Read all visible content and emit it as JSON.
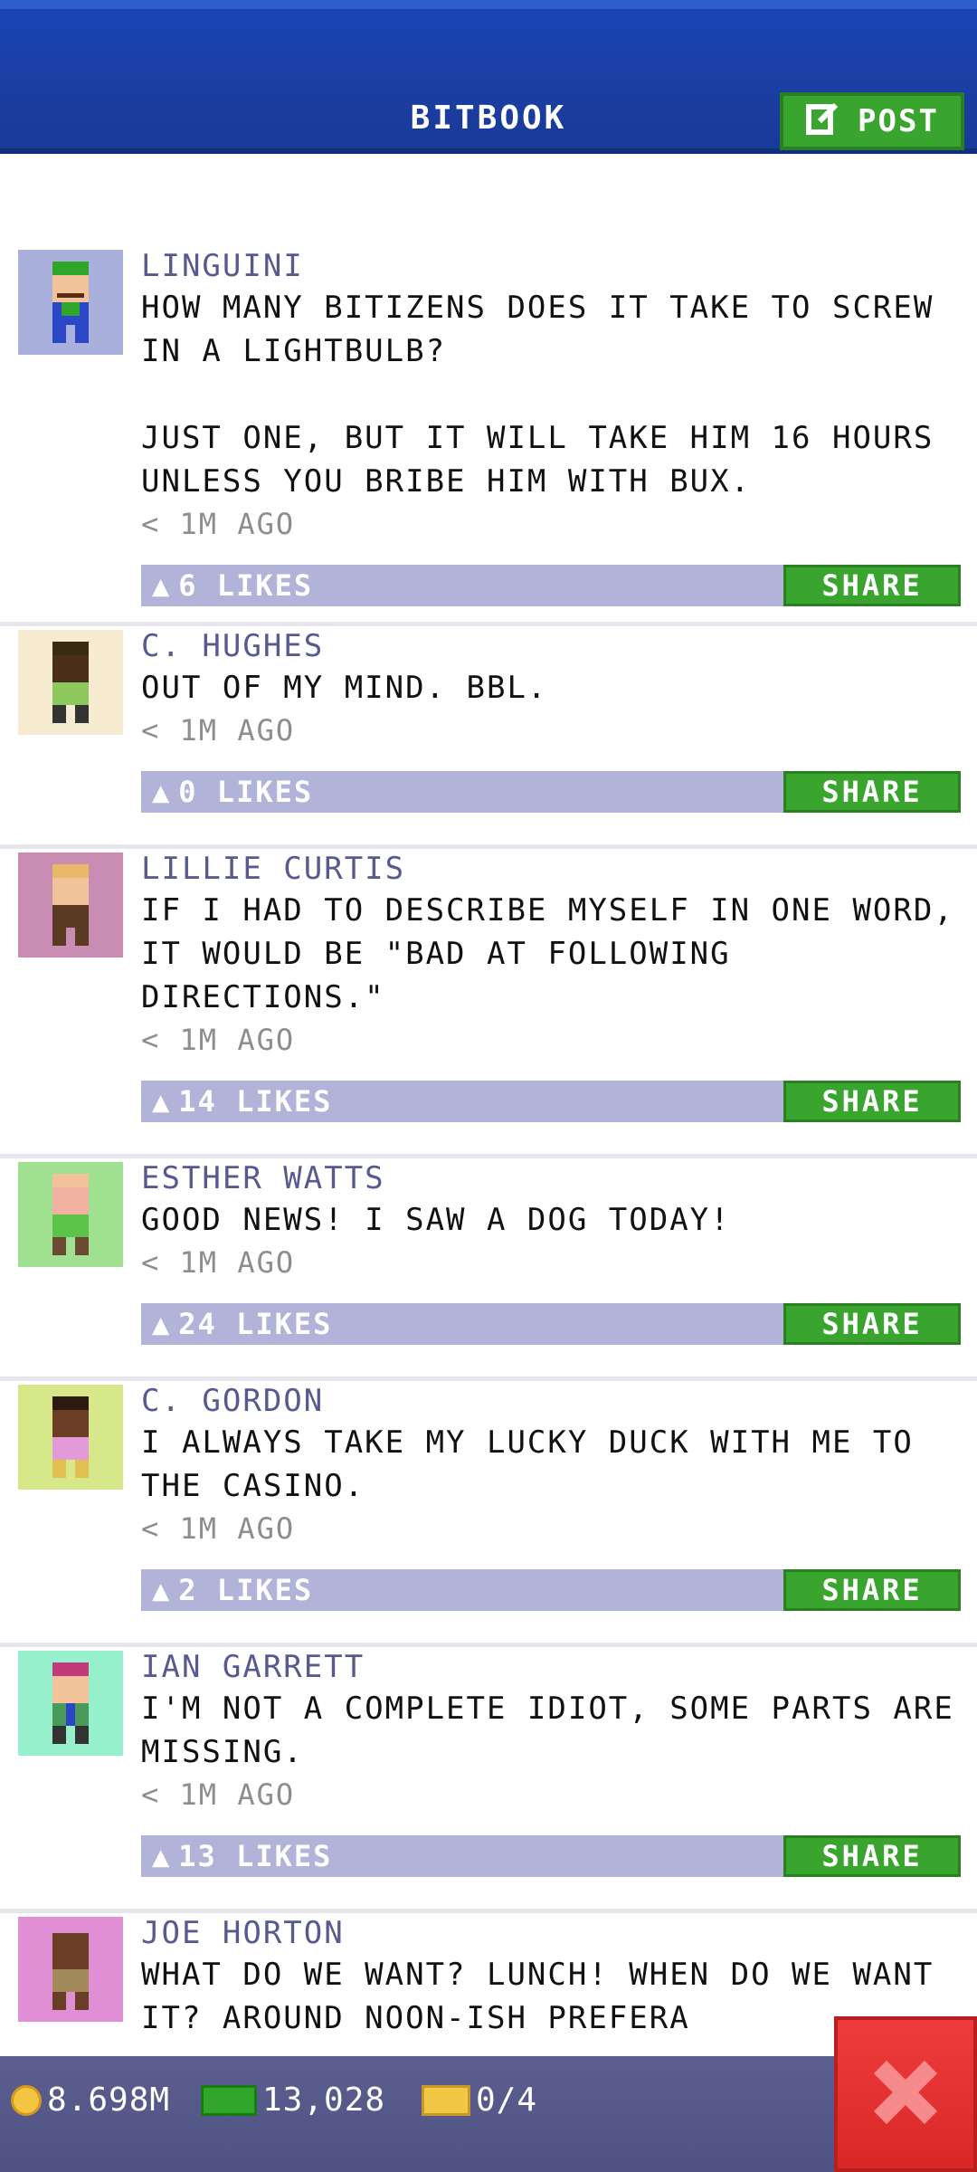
{
  "header": {
    "title": "BITBOOK",
    "post_label": "POST"
  },
  "posts": [
    {
      "author": "LINGUINI",
      "text": "HOW MANY BITIZENS DOES IT TAKE TO SCREW IN A LIGHTBULB?\n\nJUST ONE, BUT IT WILL TAKE HIM 16 HOURS UNLESS YOU BRIBE HIM WITH BUX.",
      "time": "< 1M AGO",
      "likes": "6 LIKES",
      "share": "SHARE",
      "avatar_bg": "#aab0dc"
    },
    {
      "author": "C. HUGHES",
      "text": "OUT OF MY MIND. BBL.",
      "time": "< 1M AGO",
      "likes": "0 LIKES",
      "share": "SHARE",
      "avatar_bg": "#f7ecd2"
    },
    {
      "author": "LILLIE CURTIS",
      "text": "IF I HAD TO DESCRIBE MYSELF IN ONE WORD, IT WOULD BE \"BAD AT FOLLOWING DIRECTIONS.\"",
      "time": "< 1M AGO",
      "likes": "14 LIKES",
      "share": "SHARE",
      "avatar_bg": "#c98cb2"
    },
    {
      "author": "ESTHER WATTS",
      "text": "GOOD NEWS! I SAW A DOG TODAY!",
      "time": "< 1M AGO",
      "likes": "24 LIKES",
      "share": "SHARE",
      "avatar_bg": "#9fe191"
    },
    {
      "author": "C. GORDON",
      "text": "I ALWAYS TAKE MY LUCKY DUCK WITH ME TO THE CASINO.",
      "time": "< 1M AGO",
      "likes": "2 LIKES",
      "share": "SHARE",
      "avatar_bg": "#d6e88a"
    },
    {
      "author": "IAN GARRETT",
      "text": "I'M NOT A COMPLETE IDIOT, SOME PARTS ARE MISSING.",
      "time": "< 1M AGO",
      "likes": "13 LIKES",
      "share": "SHARE",
      "avatar_bg": "#96f0cc"
    },
    {
      "author": "JOE HORTON",
      "text": "WHAT DO WE WANT? LUNCH! WHEN DO WE WANT IT? AROUND NOON-ISH PREFERA",
      "time": "",
      "likes": "",
      "share": "",
      "avatar_bg": "#e08fd4"
    }
  ],
  "status": {
    "coins": "8.698M",
    "bux": "13,028",
    "tickets": "0/4"
  },
  "colors": {
    "accent_blue": "#1b3fa3",
    "share_green": "#3aa52e",
    "close_red": "#e03030"
  }
}
